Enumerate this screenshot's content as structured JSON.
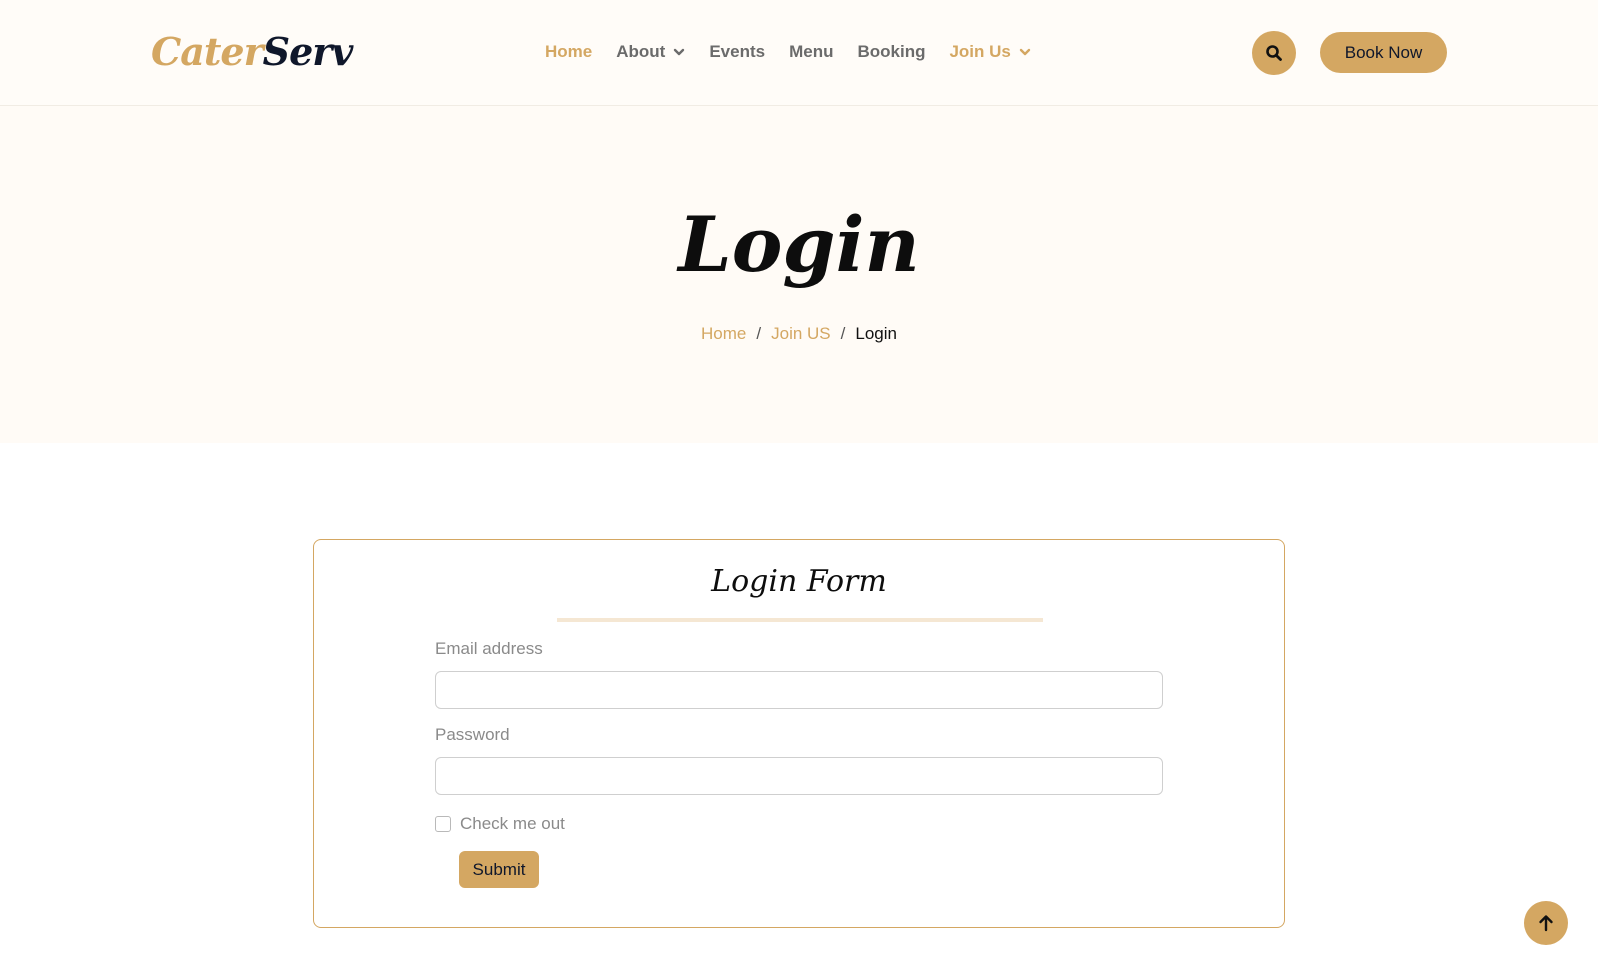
{
  "brand": {
    "logo_part1": "Cater",
    "logo_part2": "Serv",
    "accent_color": "#d4a762",
    "dark_color": "#0f172b"
  },
  "nav": {
    "items": [
      {
        "label": "Home",
        "active": true
      },
      {
        "label": "About",
        "dropdown": true
      },
      {
        "label": "Events"
      },
      {
        "label": "Menu"
      },
      {
        "label": "Booking"
      },
      {
        "label": "Join Us",
        "dropdown": true,
        "highlighted": true
      }
    ],
    "search_icon": "search-icon",
    "book_now_label": "Book Now"
  },
  "hero": {
    "title": "Login",
    "breadcrumb": {
      "home": "Home",
      "join": "Join US",
      "current": "Login",
      "separator": "/"
    }
  },
  "form": {
    "title": "Login Form",
    "email_label": "Email address",
    "email_value": "",
    "password_label": "Password",
    "password_value": "",
    "check_label": "Check me out",
    "submit_label": "Submit"
  },
  "back_to_top_icon": "arrow-up-icon"
}
